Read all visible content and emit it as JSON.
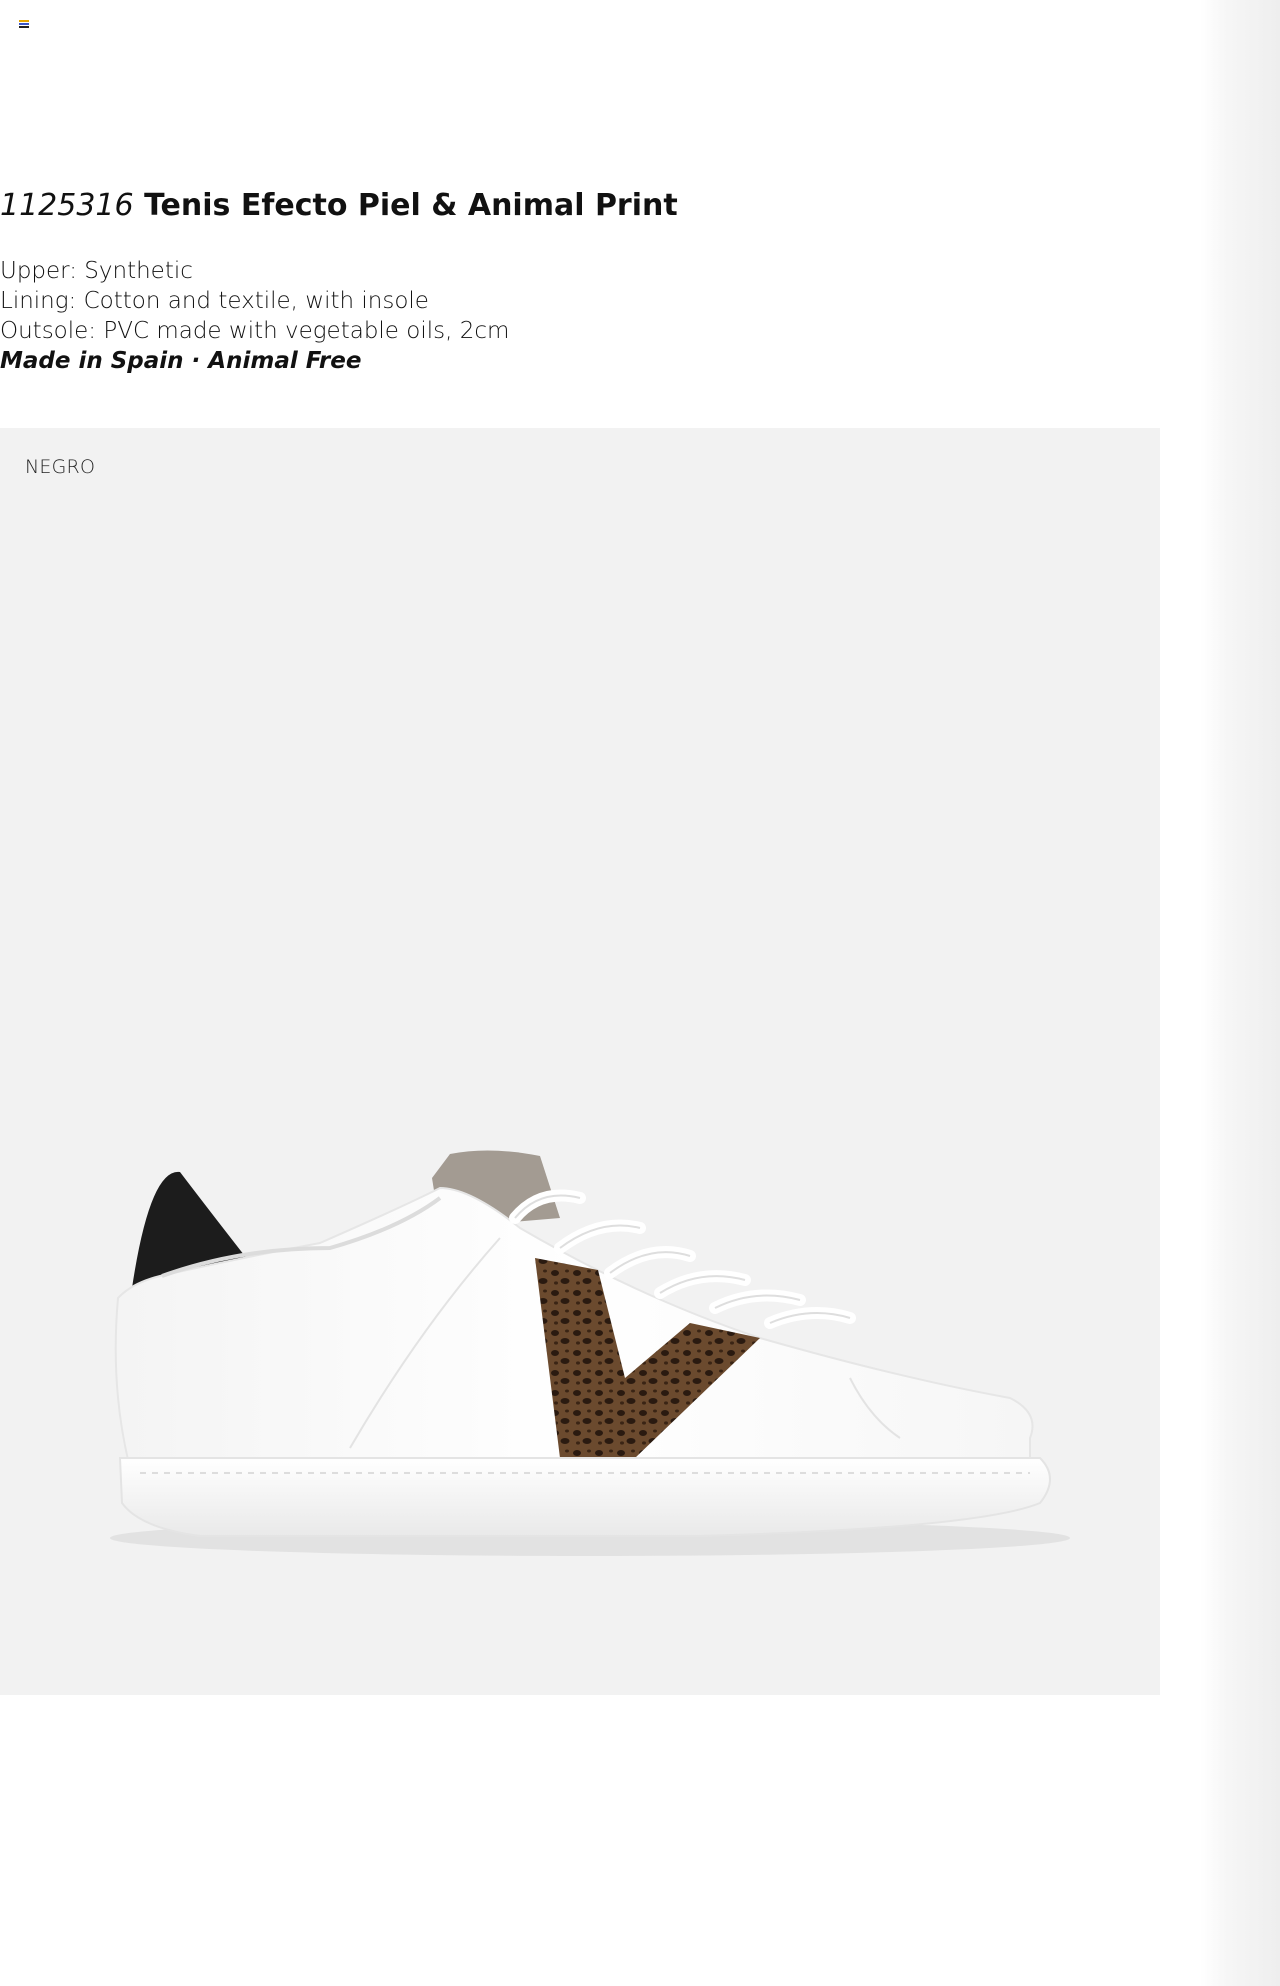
{
  "product": {
    "code": "1125316",
    "name": "Tenis Efecto Piel & Animal Print",
    "specs": [
      "Upper: Synthetic",
      "Lining: Cotton and textile, with insole",
      "Outsole: PVC made with vegetable oils, 2cm"
    ],
    "origin": "Made in Spain · Animal Free",
    "color": "NEGRO"
  },
  "icons": {
    "menu": "menu-icon"
  },
  "colors": {
    "panel_background": "#f2f2f2",
    "text": "#111111",
    "shoe_upper": "#ffffff",
    "heel_tab": "#1c1c1c",
    "v_stripe_print": "#5a3a22",
    "tongue_lining": "#a39b92"
  }
}
